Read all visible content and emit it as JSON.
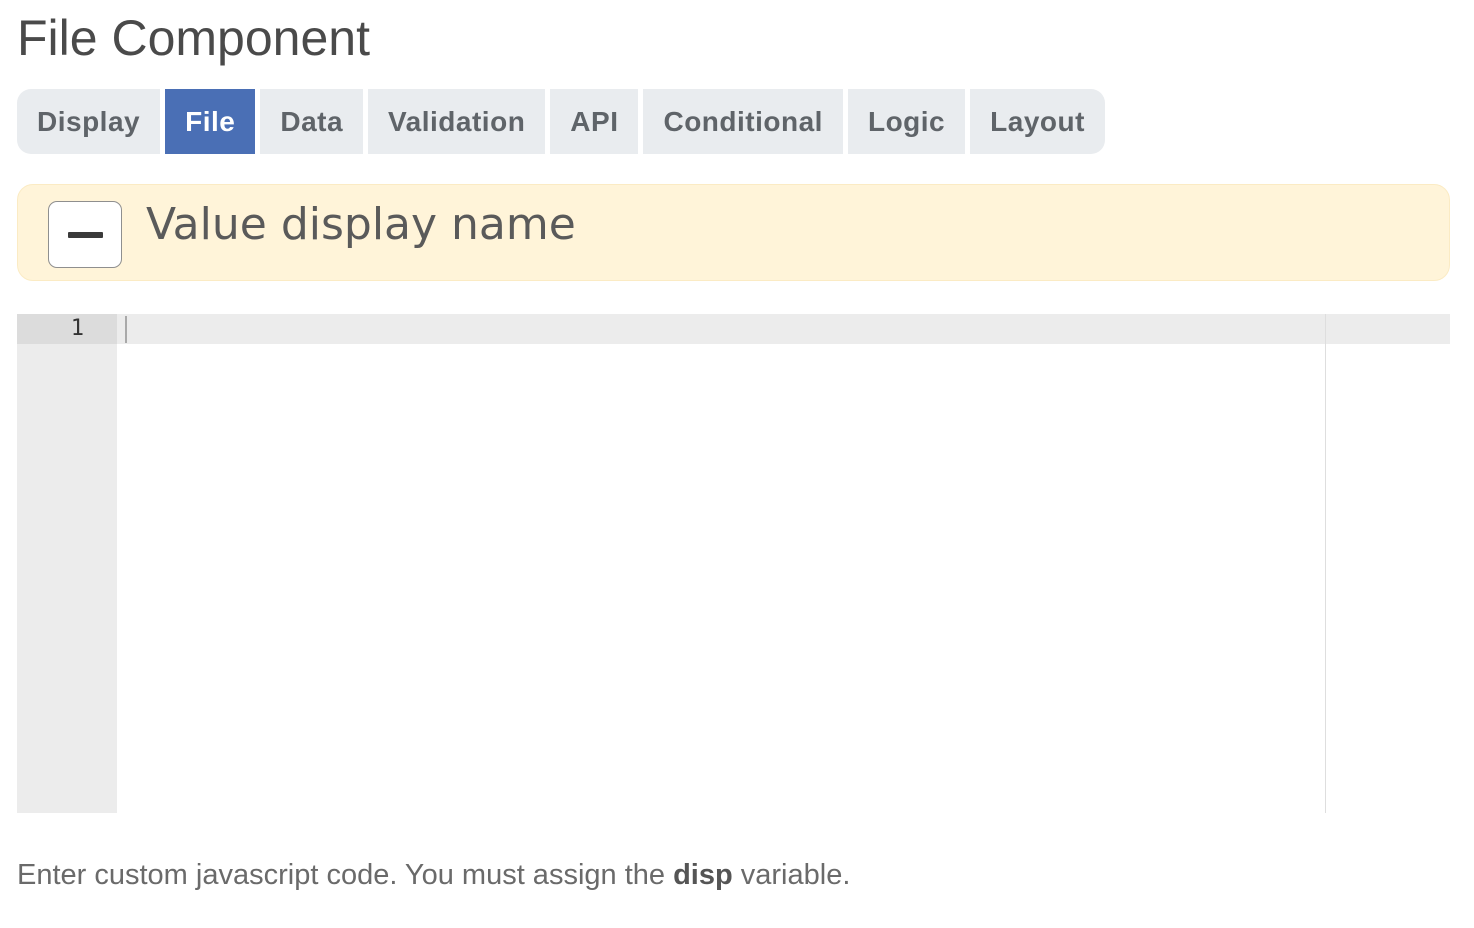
{
  "title": "File Component",
  "tabs": [
    {
      "label": "Display",
      "active": false
    },
    {
      "label": "File",
      "active": true
    },
    {
      "label": "Data",
      "active": false
    },
    {
      "label": "Validation",
      "active": false
    },
    {
      "label": "API",
      "active": false
    },
    {
      "label": "Conditional",
      "active": false
    },
    {
      "label": "Logic",
      "active": false
    },
    {
      "label": "Layout",
      "active": false
    }
  ],
  "panel": {
    "title": "Value display name",
    "toggle_icon": "minus-icon"
  },
  "editor": {
    "line_numbers": [
      "1"
    ],
    "content": ""
  },
  "help": {
    "prefix": "Enter custom javascript code. You must assign the ",
    "keyword": "disp",
    "suffix": " variable."
  },
  "colors": {
    "active_tab": "#4a6fb5",
    "tab_background": "#e9ecef",
    "panel_background": "#fff4d9"
  }
}
